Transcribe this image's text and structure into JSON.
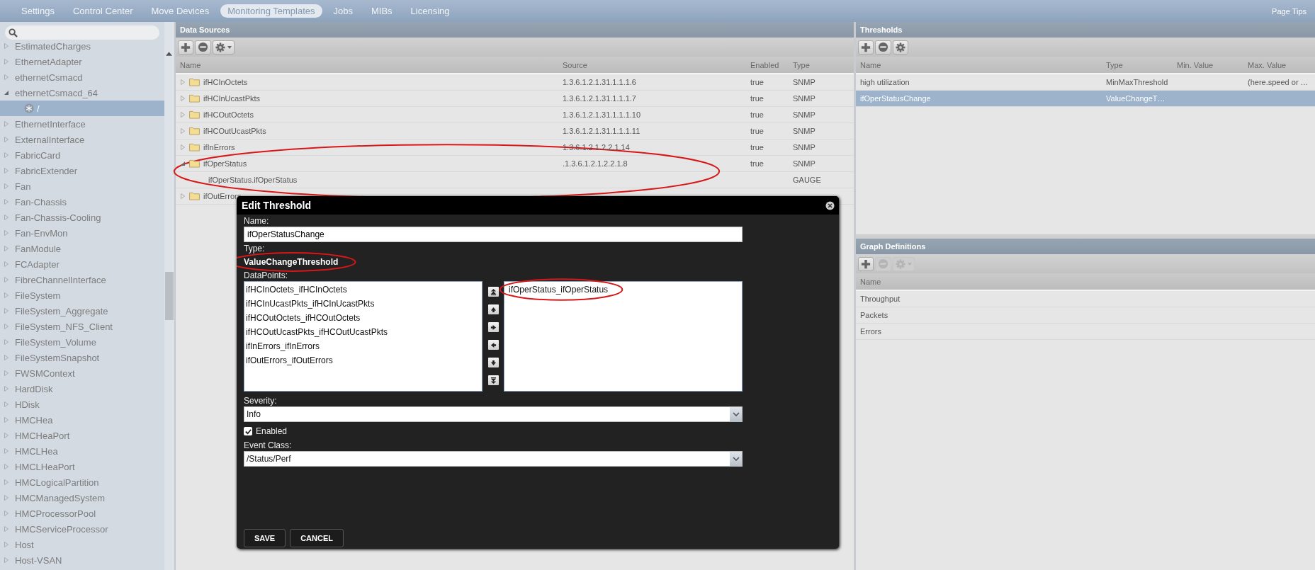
{
  "nav": {
    "tabs": [
      {
        "label": "Settings",
        "selected": false
      },
      {
        "label": "Control Center",
        "selected": false
      },
      {
        "label": "Move Devices",
        "selected": false
      },
      {
        "label": "Monitoring Templates",
        "selected": true
      },
      {
        "label": "Jobs",
        "selected": false
      },
      {
        "label": "MIBs",
        "selected": false
      },
      {
        "label": "Licensing",
        "selected": false
      }
    ],
    "page_tips": "Page Tips"
  },
  "sidebar": {
    "tree": [
      {
        "label": "EstimatedCharges",
        "expanded": false,
        "selected": false
      },
      {
        "label": "EthernetAdapter",
        "expanded": false,
        "selected": false
      },
      {
        "label": "ethernetCsmacd",
        "expanded": false,
        "selected": false
      },
      {
        "label": "ethernetCsmacd_64",
        "expanded": true,
        "selected": false,
        "children": [
          {
            "label": "/",
            "selected": true
          }
        ]
      },
      {
        "label": "EthernetInterface",
        "expanded": false,
        "selected": false
      },
      {
        "label": "ExternalInterface",
        "expanded": false,
        "selected": false
      },
      {
        "label": "FabricCard",
        "expanded": false,
        "selected": false
      },
      {
        "label": "FabricExtender",
        "expanded": false,
        "selected": false
      },
      {
        "label": "Fan",
        "expanded": false,
        "selected": false
      },
      {
        "label": "Fan-Chassis",
        "expanded": false,
        "selected": false
      },
      {
        "label": "Fan-Chassis-Cooling",
        "expanded": false,
        "selected": false
      },
      {
        "label": "Fan-EnvMon",
        "expanded": false,
        "selected": false
      },
      {
        "label": "FanModule",
        "expanded": false,
        "selected": false
      },
      {
        "label": "FCAdapter",
        "expanded": false,
        "selected": false
      },
      {
        "label": "FibreChannelInterface",
        "expanded": false,
        "selected": false
      },
      {
        "label": "FileSystem",
        "expanded": false,
        "selected": false
      },
      {
        "label": "FileSystem_Aggregate",
        "expanded": false,
        "selected": false
      },
      {
        "label": "FileSystem_NFS_Client",
        "expanded": false,
        "selected": false
      },
      {
        "label": "FileSystem_Volume",
        "expanded": false,
        "selected": false
      },
      {
        "label": "FileSystemSnapshot",
        "expanded": false,
        "selected": false
      },
      {
        "label": "FWSMContext",
        "expanded": false,
        "selected": false
      },
      {
        "label": "HardDisk",
        "expanded": false,
        "selected": false
      },
      {
        "label": "HDisk",
        "expanded": false,
        "selected": false
      },
      {
        "label": "HMCHea",
        "expanded": false,
        "selected": false
      },
      {
        "label": "HMCHeaPort",
        "expanded": false,
        "selected": false
      },
      {
        "label": "HMCLHea",
        "expanded": false,
        "selected": false
      },
      {
        "label": "HMCLHeaPort",
        "expanded": false,
        "selected": false
      },
      {
        "label": "HMCLogicalPartition",
        "expanded": false,
        "selected": false
      },
      {
        "label": "HMCManagedSystem",
        "expanded": false,
        "selected": false
      },
      {
        "label": "HMCProcessorPool",
        "expanded": false,
        "selected": false
      },
      {
        "label": "HMCServiceProcessor",
        "expanded": false,
        "selected": false
      },
      {
        "label": "Host",
        "expanded": false,
        "selected": false
      },
      {
        "label": "Host-VSAN",
        "expanded": false,
        "selected": false
      }
    ]
  },
  "data_sources": {
    "title": "Data Sources",
    "toolbar": [
      {
        "kind": "add",
        "disabled": false
      },
      {
        "kind": "remove",
        "disabled": false
      },
      {
        "kind": "menu",
        "disabled": false
      }
    ],
    "columns": [
      "Name",
      "Source",
      "Enabled",
      "Type"
    ],
    "rows": [
      {
        "name": "ifHCInOctets",
        "source": "1.3.6.1.2.1.31.1.1.1.6",
        "enabled": "true",
        "type": "SNMP",
        "expanded": false,
        "circled": false
      },
      {
        "name": "ifHCInUcastPkts",
        "source": "1.3.6.1.2.1.31.1.1.1.7",
        "enabled": "true",
        "type": "SNMP",
        "expanded": false,
        "circled": false
      },
      {
        "name": "ifHCOutOctets",
        "source": "1.3.6.1.2.1.31.1.1.1.10",
        "enabled": "true",
        "type": "SNMP",
        "expanded": false,
        "circled": false
      },
      {
        "name": "ifHCOutUcastPkts",
        "source": "1.3.6.1.2.1.31.1.1.1.11",
        "enabled": "true",
        "type": "SNMP",
        "expanded": false,
        "circled": false
      },
      {
        "name": "ifInErrors",
        "source": "1.3.6.1.2.1.2.2.1.14",
        "enabled": "true",
        "type": "SNMP",
        "expanded": false,
        "circled": false
      },
      {
        "name": "ifOperStatus",
        "source": ".1.3.6.1.2.1.2.2.1.8",
        "enabled": "true",
        "type": "SNMP",
        "expanded": true,
        "circled": true,
        "children": [
          {
            "name": "ifOperStatus.ifOperStatus",
            "type": "GAUGE"
          }
        ]
      },
      {
        "name": "ifOutErrors",
        "expanded": false,
        "circled": false
      }
    ]
  },
  "thresholds": {
    "title": "Thresholds",
    "toolbar": [
      {
        "kind": "add",
        "disabled": false
      },
      {
        "kind": "remove",
        "disabled": false
      },
      {
        "kind": "gear",
        "disabled": false
      }
    ],
    "columns": [
      "Name",
      "Type",
      "Min. Value",
      "Max. Value"
    ],
    "rows": [
      {
        "name": "high utilization",
        "type": "MinMaxThreshold",
        "max_value": "(here.speed or …",
        "selected": false
      },
      {
        "name": "ifOperStatusChange",
        "type": "ValueChangeT…",
        "selected": true
      }
    ]
  },
  "graph_definitions": {
    "title": "Graph Definitions",
    "toolbar": [
      {
        "kind": "add",
        "disabled": false
      },
      {
        "kind": "remove",
        "disabled": true
      },
      {
        "kind": "menu",
        "disabled": true
      }
    ],
    "columns": [
      "Name"
    ],
    "rows": [
      {
        "name": "Throughput",
        "selected": false
      },
      {
        "name": "Packets",
        "selected": false
      },
      {
        "name": "Errors",
        "selected": false
      }
    ]
  },
  "dialog": {
    "title": "Edit Threshold",
    "name": {
      "label": "Name:",
      "value": "ifOperStatusChange"
    },
    "type": {
      "label": "Type:",
      "value": "ValueChangeThreshold",
      "circled": true
    },
    "datapoints": {
      "label": "DataPoints:",
      "available": [
        {
          "label": "ifHCInOctets_ifHCInOctets",
          "selected": false
        },
        {
          "label": "ifHCInUcastPkts_ifHCInUcastPkts",
          "selected": false
        },
        {
          "label": "ifHCOutOctets_ifHCOutOctets",
          "selected": false
        },
        {
          "label": "ifHCOutUcastPkts_ifHCOutUcastPkts",
          "selected": false
        },
        {
          "label": "ifInErrors_ifInErrors",
          "selected": false
        },
        {
          "label": "ifOutErrors_ifOutErrors",
          "selected": false
        }
      ],
      "moves": [
        {
          "kind": "top"
        },
        {
          "kind": "up"
        },
        {
          "kind": "right"
        },
        {
          "kind": "left"
        },
        {
          "kind": "down"
        },
        {
          "kind": "bottom"
        }
      ],
      "chosen": [
        {
          "label": "ifOperStatus_ifOperStatus",
          "selected": false,
          "circled": true
        }
      ]
    },
    "severity": {
      "label": "Severity:",
      "value": "Info"
    },
    "enabled": {
      "label": "Enabled",
      "checked": true
    },
    "event_class": {
      "label": "Event Class:",
      "value": "/Status/Perf"
    },
    "buttons": [
      {
        "label": "SAVE"
      },
      {
        "label": "CANCEL"
      }
    ]
  }
}
